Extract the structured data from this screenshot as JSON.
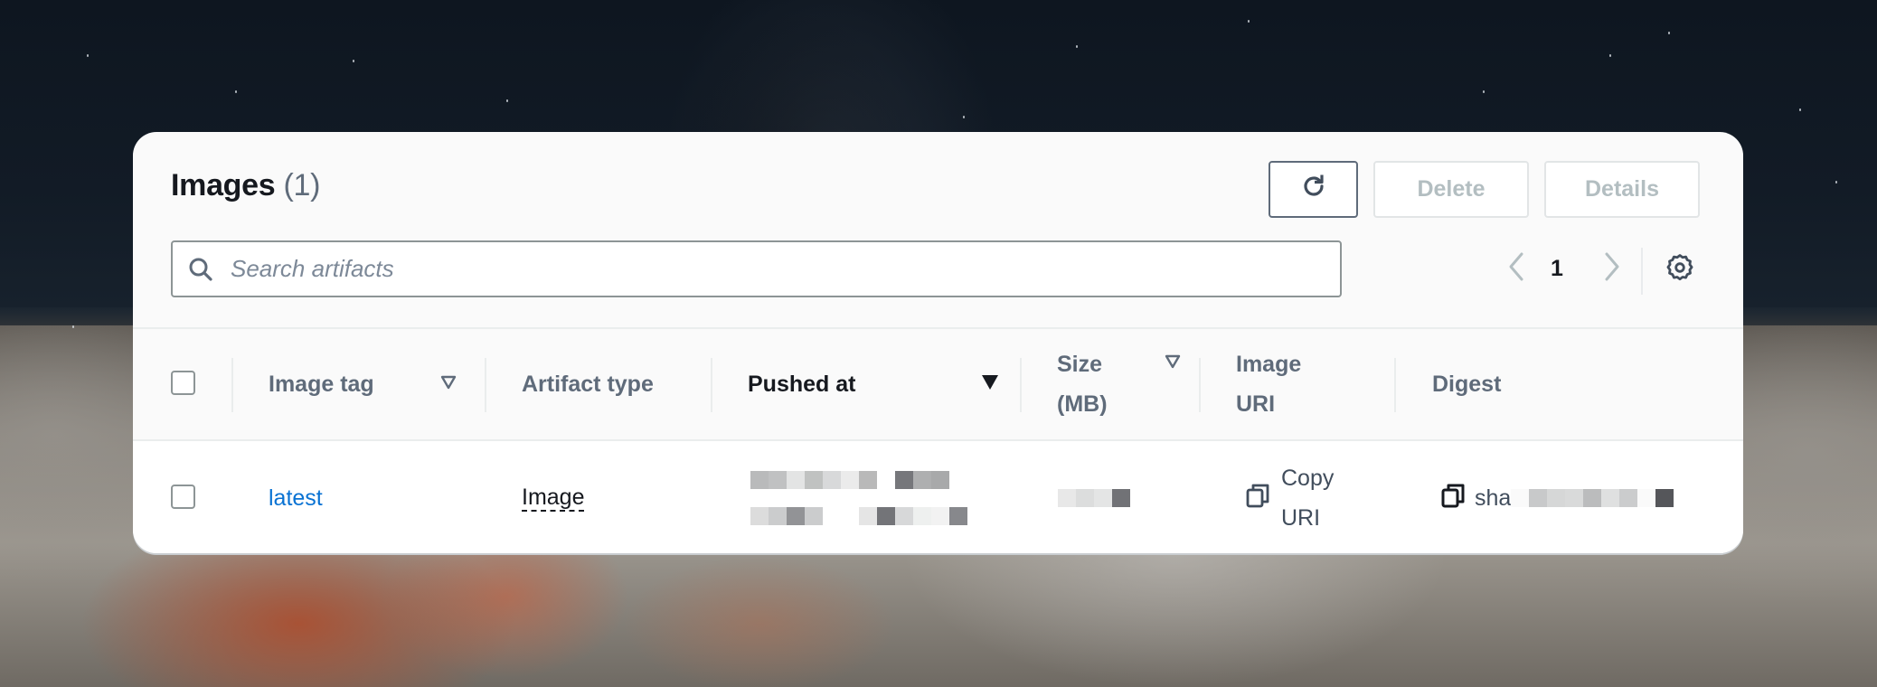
{
  "panel": {
    "title": "Images",
    "count": "(1)",
    "buttons": {
      "refresh_icon": "refresh-icon",
      "delete": "Delete",
      "details": "Details"
    },
    "search": {
      "placeholder": "Search artifacts",
      "value": ""
    },
    "pagination": {
      "current_page": "1",
      "prev_icon": "chevron-left-icon",
      "next_icon": "chevron-right-icon"
    },
    "settings_icon": "gear-icon"
  },
  "table": {
    "columns": [
      {
        "label": "Image tag",
        "sortable": true,
        "sorted": false
      },
      {
        "label": "Artifact type",
        "sortable": false,
        "sorted": false
      },
      {
        "label": "Pushed at",
        "sortable": true,
        "sorted": true,
        "direction": "descending"
      },
      {
        "label": "Size (MB)",
        "label_lines": [
          "Size",
          "(MB)"
        ],
        "sortable": true,
        "sorted": false
      },
      {
        "label": "Image URI",
        "label_lines": [
          "Image",
          "URI"
        ],
        "sortable": false,
        "sorted": false
      },
      {
        "label": "Digest",
        "sortable": false,
        "sorted": false
      }
    ],
    "rows": [
      {
        "selected": false,
        "image_tag": "latest",
        "artifact_type": "Image",
        "pushed_at": "[redacted]",
        "size_mb": "[redacted]",
        "image_uri_action": [
          "Copy",
          "URI"
        ],
        "digest_prefix": "sha",
        "digest_rest": "[redacted]"
      }
    ]
  },
  "colors": {
    "link": "#0972d3",
    "text_primary": "#16191f",
    "text_secondary": "#5f6b7a",
    "disabled": "#b3bec1",
    "panel_bg": "#fafafa"
  }
}
